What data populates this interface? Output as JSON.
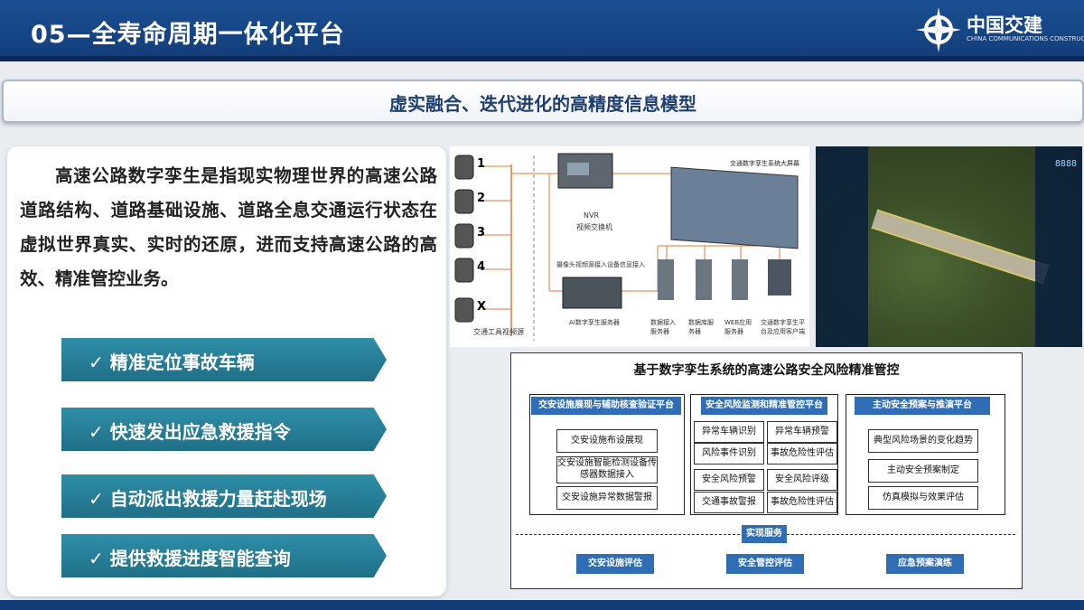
{
  "header": {
    "title": "05—全寿命周期一体化平台",
    "logo_text": "中国交建",
    "logo_sub": "CHINA COMMUNICATIONS CONSTRUCTION"
  },
  "banner": {
    "text": "虚实融合、迭代进化的高精度信息模型"
  },
  "intro": {
    "paragraph": "高速公路数字孪生是指现实物理世界的高速公路道路结构、道路基础设施、道路全息交通运行状态在虚拟世界真实、实时的还原，进而支持高速公路的高效、精准管控业务。"
  },
  "features": [
    {
      "label": "✓ 精准定位事故车辆"
    },
    {
      "label": "✓ 快速发出应急救援指令"
    },
    {
      "label": "✓ 自动派出救援力量赶赴现场"
    },
    {
      "label": "✓ 提供救援进度智能查询"
    }
  ],
  "camera_diagram": {
    "camera_labels": [
      "1",
      "2",
      "3",
      "4",
      "X"
    ],
    "camera_caption": "交通工具视频源",
    "nvr_label": "NVR",
    "nvr_caption": "视频交换机",
    "screen_caption": "交通数字孪生系统大屏幕",
    "access_caption": "摄像头视频源接入设备信息接入",
    "ai_caption": "AI数字孪生服务器",
    "servers": [
      "数据接入服务器",
      "数据库服务器",
      "WEB应用服务器",
      "交通数字孪生平台及应用客户端"
    ]
  },
  "map_panel": {
    "digits": "8888"
  },
  "system_diagram": {
    "title": "基于数字孪生系统的高速公路安全风险精准管控",
    "groups": [
      {
        "title": "交安设施展现与辅助核查验证平台",
        "items": [
          "交安设施布设展现",
          "交安设施智能检测设备传感器数据接入",
          "交安设施异常数据警报"
        ]
      },
      {
        "title": "安全风险监测和精准管控平台",
        "items": [
          "异常车辆识别",
          "异常车辆预警",
          "风险事件识别",
          "事故危险性评估",
          "安全风险预警",
          "安全风险评级",
          "交通事故警报",
          "事故危险性评估"
        ]
      },
      {
        "title": "主动安全预案与推演平台",
        "items": [
          "典型风险场景的变化趋势",
          "主动安全预案制定",
          "仿真模拟与效果评估"
        ]
      }
    ],
    "service_label": "实现服务",
    "services": [
      "交安设施评估",
      "安全管控评估",
      "应急预案演练"
    ]
  }
}
